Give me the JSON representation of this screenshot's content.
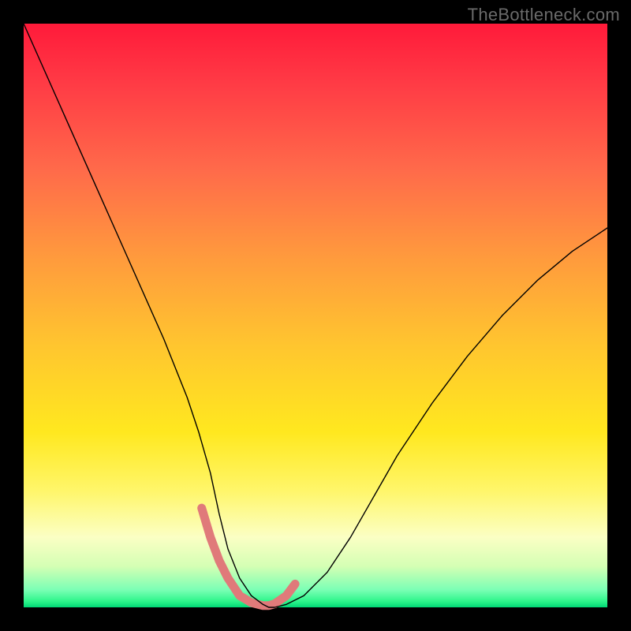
{
  "watermark": "TheBottleneck.com",
  "chart_data": {
    "type": "line",
    "title": "",
    "xlabel": "",
    "ylabel": "",
    "xlim": [
      0,
      100
    ],
    "ylim": [
      0,
      100
    ],
    "grid": false,
    "series": [
      {
        "name": "black-curve",
        "color": "#000000",
        "width": 1.4,
        "x": [
          0,
          4,
          8,
          12,
          16,
          20,
          24,
          28,
          30,
          32,
          33.5,
          35,
          37,
          39,
          41,
          42,
          43,
          45,
          48,
          52,
          56,
          60,
          64,
          70,
          76,
          82,
          88,
          94,
          100
        ],
        "y": [
          100,
          91,
          82,
          73,
          64,
          55,
          46,
          36,
          30,
          23,
          16,
          10,
          5,
          2,
          0.5,
          0,
          0,
          0.5,
          2,
          6,
          12,
          19,
          26,
          35,
          43,
          50,
          56,
          61,
          65
        ]
      },
      {
        "name": "pink-highlight",
        "color": "#e07a7a",
        "width": 11,
        "x": [
          30.5,
          32,
          33.5,
          35,
          37,
          39,
          41,
          42,
          43,
          45,
          46.5
        ],
        "y": [
          17,
          12,
          8,
          5,
          2,
          0.8,
          0.3,
          0.3,
          0.6,
          2,
          4
        ]
      }
    ],
    "gradient_stops": [
      {
        "pos": 0,
        "color": "#ff1a3a"
      },
      {
        "pos": 10,
        "color": "#ff3a45"
      },
      {
        "pos": 25,
        "color": "#ff6a4a"
      },
      {
        "pos": 40,
        "color": "#ff9a3d"
      },
      {
        "pos": 55,
        "color": "#ffc52f"
      },
      {
        "pos": 70,
        "color": "#ffe81f"
      },
      {
        "pos": 80,
        "color": "#fff66a"
      },
      {
        "pos": 88,
        "color": "#fbffc4"
      },
      {
        "pos": 93,
        "color": "#d4ffb4"
      },
      {
        "pos": 97,
        "color": "#7bffb5"
      },
      {
        "pos": 99,
        "color": "#2cf58a"
      },
      {
        "pos": 100,
        "color": "#00d876"
      }
    ]
  }
}
